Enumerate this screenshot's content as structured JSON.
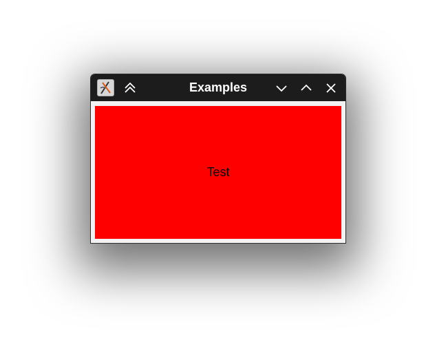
{
  "window": {
    "title": "Examples"
  },
  "titlebar": {
    "app_icon": "app-icon",
    "buttons": [
      {
        "name": "shade-button",
        "icon": "double-chevron-up-icon"
      },
      {
        "name": "minimize-button",
        "icon": "chevron-down-icon"
      },
      {
        "name": "maximize-button",
        "icon": "chevron-up-icon"
      },
      {
        "name": "close-button",
        "icon": "close-icon"
      }
    ]
  },
  "content": {
    "label": "Test",
    "background_color": "#ff0000"
  }
}
